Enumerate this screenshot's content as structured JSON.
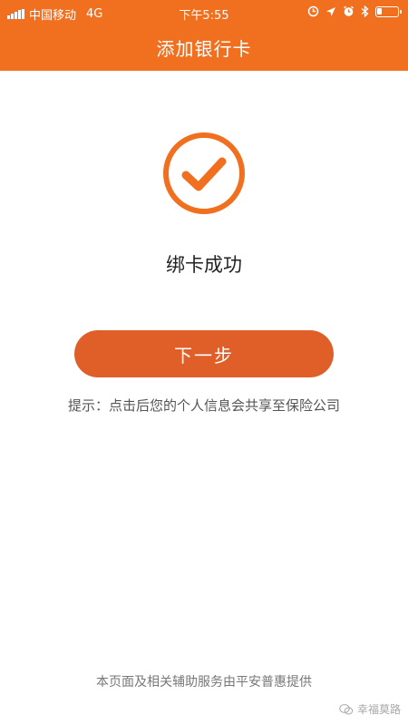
{
  "status_bar": {
    "carrier": "中国移动",
    "network": "4G",
    "time": "下午5:55",
    "battery_level": 0.25
  },
  "header": {
    "title": "添加银行卡"
  },
  "main": {
    "success_message": "绑卡成功",
    "next_button_label": "下一步",
    "hint": "提示：点击后您的个人信息会共享至保险公司"
  },
  "footer": {
    "provider_note": "本页面及相关辅助服务由平安普惠提供"
  },
  "watermark": {
    "text": "幸福莫路"
  },
  "colors": {
    "brand": "#f07020",
    "button": "#e05f28",
    "icon": "#f07020"
  },
  "icons": [
    "signal-icon",
    "alarm-icon",
    "location-icon",
    "clock-icon",
    "bluetooth-icon",
    "battery-icon",
    "check-circle-icon",
    "wechat-icon"
  ]
}
